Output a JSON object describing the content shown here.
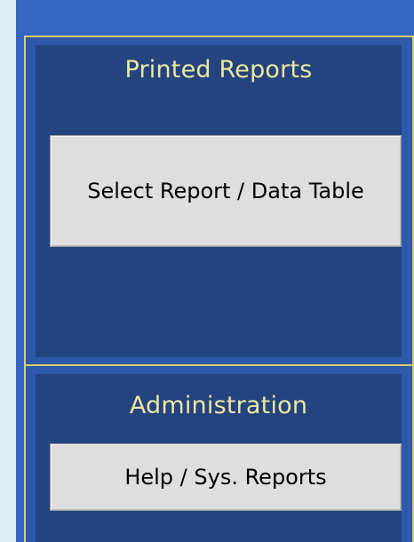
{
  "printed_reports": {
    "title": "Printed Reports",
    "select_report_button_label": "Select Report / Data Table"
  },
  "administration": {
    "title": "Administration",
    "help_button_label": "Help / Sys. Reports"
  },
  "colors": {
    "outer_background": "#3566c4",
    "panel_background": "#23447f",
    "border_yellow": "#d8cf63",
    "title_text": "#eee79e",
    "button_background": "#dedede"
  }
}
